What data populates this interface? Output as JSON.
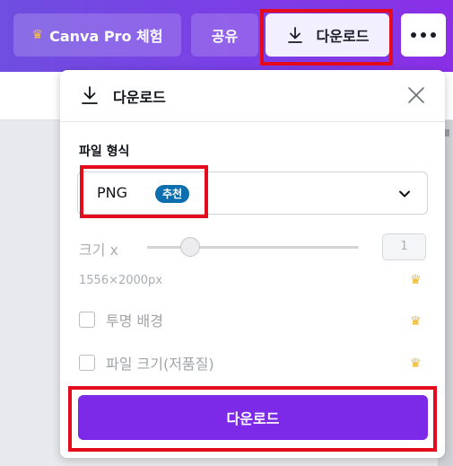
{
  "topbar": {
    "pro_label": "Canva Pro 체험",
    "share_label": "공유",
    "download_label": "다운로드",
    "more_icon": "more-dots-icon"
  },
  "panel": {
    "title": "다운로드",
    "file_type_label": "파일 형식",
    "file_type_value": "PNG",
    "recommended_badge": "추천",
    "size_label": "크기 x",
    "size_value": "1",
    "dimensions": "1556×2000px",
    "transparent_bg_label": "투명 배경",
    "compress_label": "파일 크기(저품질)",
    "download_button": "다운로드"
  },
  "colors": {
    "accent": "#7d2ae8",
    "badge": "#0b6eaf",
    "crown": "#f2b417",
    "highlight": "#e30b1c"
  }
}
